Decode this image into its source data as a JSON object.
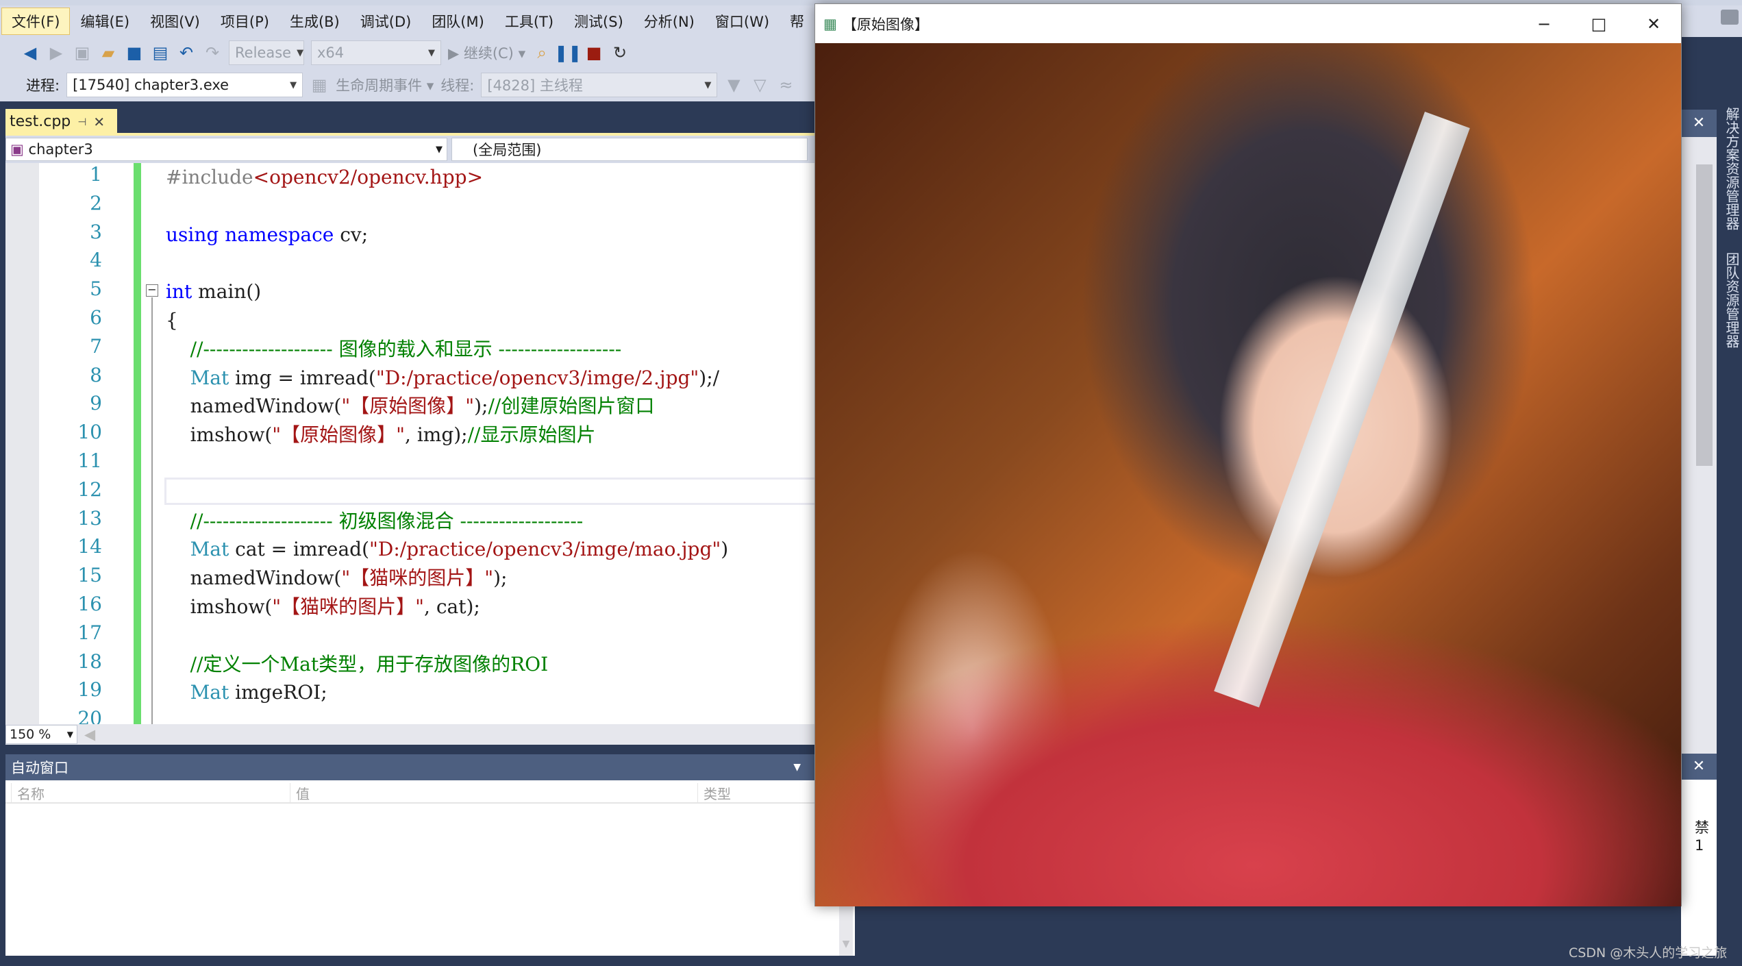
{
  "menu": [
    "文件(F)",
    "编辑(E)",
    "视图(V)",
    "项目(P)",
    "生成(B)",
    "调试(D)",
    "团队(M)",
    "工具(T)",
    "测试(S)",
    "分析(N)",
    "窗口(W)",
    "帮"
  ],
  "toolbar": {
    "config": "Release",
    "platform": "x64",
    "continue": "继续(C)"
  },
  "debugbar": {
    "process_label": "进程:",
    "process_value": "[17540] chapter3.exe",
    "lifecycle": "生命周期事件",
    "thread_label": "线程:",
    "thread_value": "[4828] 主线程"
  },
  "editor": {
    "tab": "test.cpp",
    "project": "chapter3",
    "scope": "(全局范围)",
    "zoom": "150 %",
    "lines": [
      [
        {
          "t": "#include",
          "k": "pre"
        },
        {
          "t": "<opencv2/opencv.hpp>",
          "k": "string"
        }
      ],
      [],
      [
        {
          "t": "using",
          "k": "keyword"
        },
        {
          "t": " ",
          "k": "plain"
        },
        {
          "t": "namespace",
          "k": "keyword"
        },
        {
          "t": " cv;",
          "k": "plain"
        }
      ],
      [],
      [
        {
          "t": "int",
          "k": "keyword"
        },
        {
          "t": " main()",
          "k": "plain"
        }
      ],
      [
        {
          "t": "{",
          "k": "plain"
        }
      ],
      [
        {
          "t": "    //-------------------- 图像的载入和显示 -------------------",
          "k": "comment"
        }
      ],
      [
        {
          "t": "    ",
          "k": "plain"
        },
        {
          "t": "Mat",
          "k": "type"
        },
        {
          "t": " img = imread(",
          "k": "plain"
        },
        {
          "t": "\"D:/practice/opencv3/imge/2.jpg\"",
          "k": "string"
        },
        {
          "t": ");/",
          "k": "plain"
        }
      ],
      [
        {
          "t": "    namedWindow(",
          "k": "plain"
        },
        {
          "t": "\"【原始图像】\"",
          "k": "string"
        },
        {
          "t": ");",
          "k": "plain"
        },
        {
          "t": "//创建原始图片窗口",
          "k": "comment"
        }
      ],
      [
        {
          "t": "    imshow(",
          "k": "plain"
        },
        {
          "t": "\"【原始图像】\"",
          "k": "string"
        },
        {
          "t": ", img);",
          "k": "plain"
        },
        {
          "t": "//显示原始图片",
          "k": "comment"
        }
      ],
      [],
      [],
      [
        {
          "t": "    //-------------------- 初级图像混合 -------------------",
          "k": "comment"
        }
      ],
      [
        {
          "t": "    ",
          "k": "plain"
        },
        {
          "t": "Mat",
          "k": "type"
        },
        {
          "t": " cat = imread(",
          "k": "plain"
        },
        {
          "t": "\"D:/practice/opencv3/imge/mao.jpg\"",
          "k": "string"
        },
        {
          "t": ")",
          "k": "plain"
        }
      ],
      [
        {
          "t": "    namedWindow(",
          "k": "plain"
        },
        {
          "t": "\"【猫咪的图片】\"",
          "k": "string"
        },
        {
          "t": ");",
          "k": "plain"
        }
      ],
      [
        {
          "t": "    imshow(",
          "k": "plain"
        },
        {
          "t": "\"【猫咪的图片】\"",
          "k": "string"
        },
        {
          "t": ", cat);",
          "k": "plain"
        }
      ],
      [],
      [
        {
          "t": "    //定义一个Mat类型，用于存放图像的ROI",
          "k": "comment"
        }
      ],
      [
        {
          "t": "    ",
          "k": "plain"
        },
        {
          "t": "Mat",
          "k": "type"
        },
        {
          "t": " imgeROI;",
          "k": "plain"
        }
      ],
      []
    ]
  },
  "autos": {
    "title": "自动窗口",
    "columns": [
      "名称",
      "值",
      "类型"
    ]
  },
  "image_window": {
    "title": "【原始图像】"
  },
  "right_sidebar": [
    "解决方案资源管理器",
    "团队资源管理器"
  ],
  "right_panel": {
    "partial_text": "禁1"
  },
  "watermark": "CSDN @木头人的学习之旅"
}
